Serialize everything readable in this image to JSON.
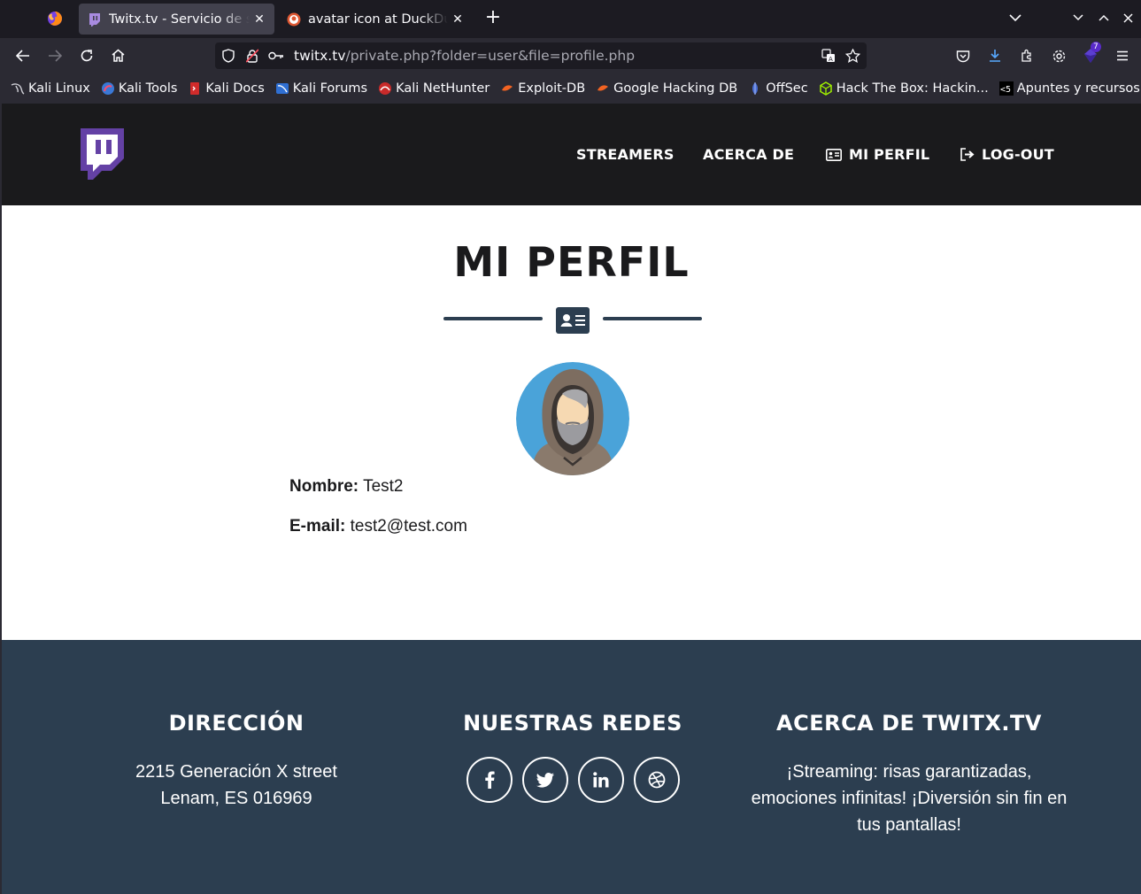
{
  "browser": {
    "tabs": [
      {
        "title": "Twitx.tv - Servicio de streaming",
        "active": true
      },
      {
        "title": "avatar icon at DuckDuckGo",
        "active": false
      }
    ],
    "url": {
      "host": "twitx.tv",
      "path": "/private.php?folder=user&file=profile.php"
    },
    "extension_badge": "7",
    "bookmarks": [
      {
        "label": "Kali Linux",
        "icon": "kali-dragon-icon"
      },
      {
        "label": "Kali Tools",
        "icon": "kali-tools-icon"
      },
      {
        "label": "Kali Docs",
        "icon": "kali-docs-icon"
      },
      {
        "label": "Kali Forums",
        "icon": "kali-forums-icon"
      },
      {
        "label": "Kali NetHunter",
        "icon": "nethunter-icon"
      },
      {
        "label": "Exploit-DB",
        "icon": "exploit-db-icon"
      },
      {
        "label": "Google Hacking DB",
        "icon": "ghdb-icon"
      },
      {
        "label": "OffSec",
        "icon": "offsec-icon"
      },
      {
        "label": "Hack The Box: Hackin...",
        "icon": "htb-icon"
      },
      {
        "label": "Apuntes y recursos R...",
        "icon": "apuntes-icon"
      }
    ]
  },
  "site": {
    "nav": {
      "streamers": "STREAMERS",
      "about": "ACERCA DE",
      "profile": "MI PERFIL",
      "logout": "LOG-OUT"
    },
    "profile": {
      "title": "MI PERFIL",
      "name_label": "Nombre:",
      "name_value": "Test2",
      "email_label": "E-mail:",
      "email_value": "test2@test.com"
    },
    "footer": {
      "address_title": "DIRECCIÓN",
      "address_line1": "2215 Generación X street",
      "address_line2": "Lenam, ES 016969",
      "social_title": "NUESTRAS REDES",
      "social_icons": [
        "facebook-icon",
        "twitter-icon",
        "linkedin-icon",
        "dribbble-icon"
      ],
      "about_title": "ACERCA DE TWITX.TV",
      "about_text": "¡Streaming: risas garantizadas, emociones infinitas! ¡Diversión sin fin en tus pantallas!"
    }
  },
  "colors": {
    "header_bg": "#1a1a1c",
    "footer_bg": "#2c3e50",
    "brand_purple": "#6441a5",
    "avatar_bg": "#4aa3d9"
  }
}
